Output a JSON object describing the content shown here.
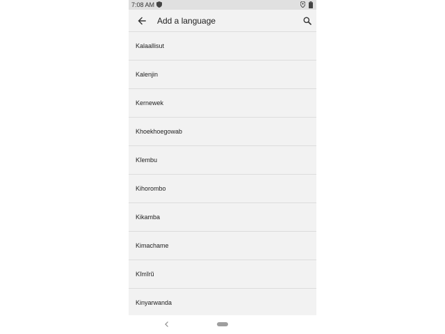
{
  "status_bar": {
    "time": "7:08 AM",
    "icons": [
      "shield-icon",
      "location-icon",
      "battery-icon"
    ]
  },
  "app_bar": {
    "title": "Add a language",
    "back_icon": "arrow-back-icon",
    "search_icon": "search-icon"
  },
  "languages": [
    "Kalaallisut",
    "Kalenjin",
    "Kernewek",
    "Khoekhoegowab",
    "Kĩembu",
    "Kihorombo",
    "Kikamba",
    "Kimachame",
    "Kĩmĩrũ",
    "Kinyarwanda"
  ],
  "nav_bar": {
    "back_icon": "nav-back-icon",
    "home_icon": "nav-home-pill"
  },
  "colors": {
    "background": "#f2f2f2",
    "status_bar": "#e0e0e0",
    "divider": "#dcdcdc",
    "text": "#222222"
  }
}
